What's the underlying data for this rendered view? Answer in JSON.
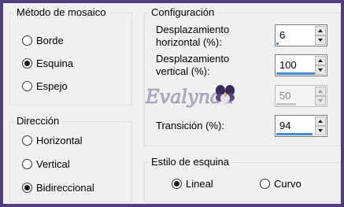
{
  "mosaic_method": {
    "legend": "Método de mosaico",
    "options": [
      {
        "label": "Borde",
        "checked": false
      },
      {
        "label": "Esquina",
        "checked": true
      },
      {
        "label": "Espejo",
        "checked": false
      }
    ]
  },
  "direction": {
    "legend": "Dirección",
    "options": [
      {
        "label": "Horizontal",
        "checked": false
      },
      {
        "label": "Vertical",
        "checked": false
      },
      {
        "label": "Bidireccional",
        "checked": true
      }
    ]
  },
  "config": {
    "legend": "Configuración",
    "horizontal_offset": {
      "label_line1": "Desplazamiento",
      "label_line2": "horizontal (%):",
      "value": "6",
      "fill_fraction": 0.06
    },
    "vertical_offset": {
      "label_line1": "Desplazamiento",
      "label_line2": "vertical (%):",
      "value": "100",
      "fill_fraction": 1.0
    },
    "disabled_field": {
      "value": "50",
      "fill_fraction": 0.5
    },
    "transition": {
      "label": "Transición (%):",
      "value": "94",
      "fill_fraction": 0.94
    }
  },
  "corner_style": {
    "legend": "Estilo de esquina",
    "options": [
      {
        "label": "Lineal",
        "checked": true
      },
      {
        "label": "Curvo",
        "checked": false
      }
    ]
  },
  "watermark": {
    "text": "Evalynda"
  },
  "colors": {
    "frame": "#533d7e",
    "accent_bar": "#3e8ede"
  }
}
